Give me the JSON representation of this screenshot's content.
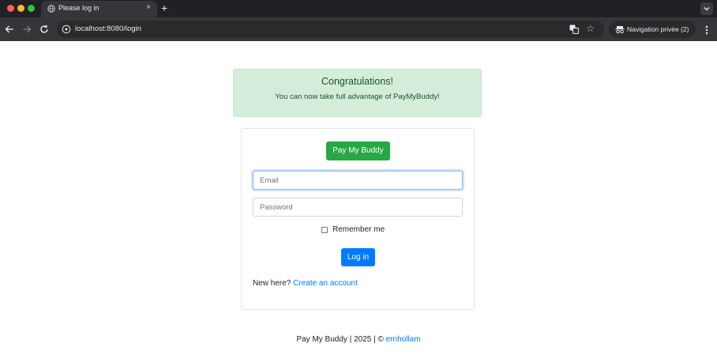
{
  "browser": {
    "tab_title": "Please log in",
    "tab_close": "×",
    "new_tab": "+",
    "url": "localhost:8080/login",
    "star": "☆",
    "incognito_label": "Navigation privée (2)"
  },
  "alert": {
    "title": "Congratulations!",
    "message": "You can now take full advantage of PayMyBuddy!"
  },
  "login": {
    "brand": "Pay My Buddy",
    "email_placeholder": "Email",
    "password_placeholder": "Password",
    "remember": "Remember me",
    "submit": "Log in",
    "signup_text": "New here?",
    "signup_link": "Create an account"
  },
  "footer": {
    "text": "Pay My Buddy | 2025 | © ",
    "author": "ernhollam"
  },
  "colors": {
    "success": "#28a745",
    "primary": "#007bff",
    "alert_bg": "#d4edda",
    "alert_text": "#155724"
  }
}
